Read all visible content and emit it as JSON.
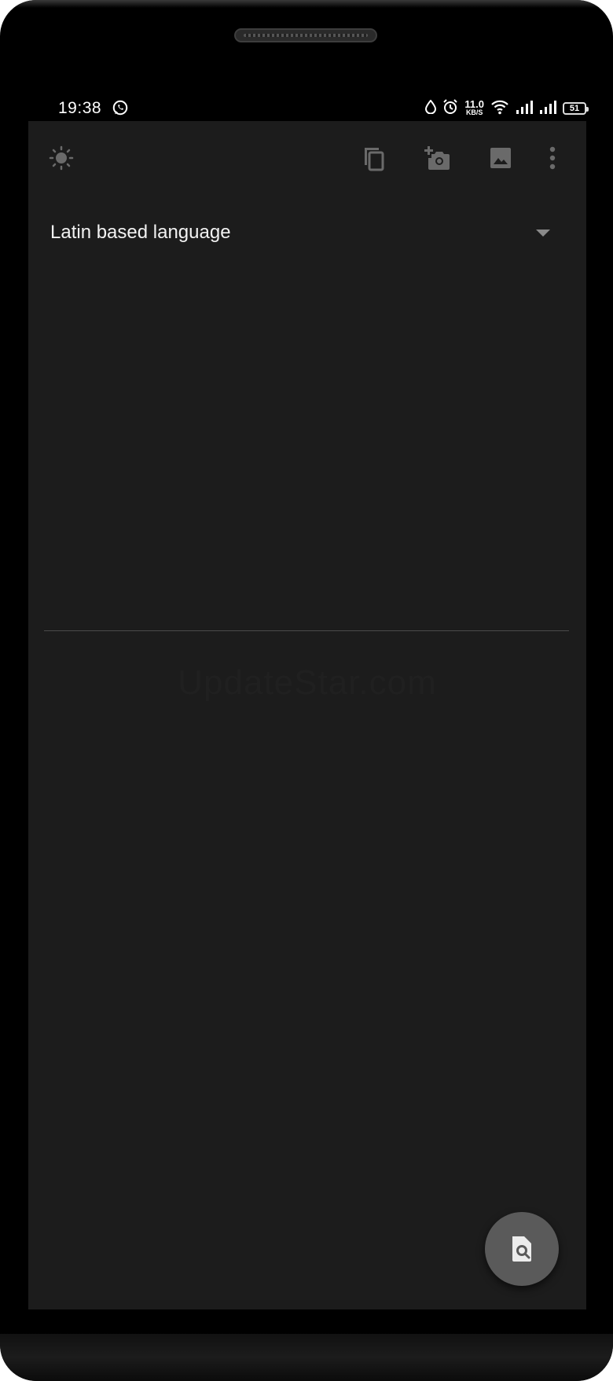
{
  "status_bar": {
    "time": "19:38",
    "net_speed_value": "11.0",
    "net_speed_unit": "KB/S",
    "battery_level": "51",
    "icons": [
      "whatsapp-icon",
      "drop-icon",
      "alarm-icon",
      "wifi-icon",
      "signal-icon",
      "signal-icon",
      "battery-icon"
    ]
  },
  "toolbar": {
    "icons": [
      "brightness-icon",
      "copy-icon",
      "add-photo-icon",
      "image-icon",
      "more-vert-icon"
    ]
  },
  "language_selector": {
    "selected": "Latin based language"
  },
  "watermark": {
    "text": "UpdateStar.com"
  },
  "fab": {
    "icon": "document-search-icon"
  },
  "colors": {
    "screen_background": "#1c1c1c",
    "icon_gray": "#6a6a6a",
    "fab_background": "#5a5a5a",
    "divider": "#4a4a4a"
  }
}
